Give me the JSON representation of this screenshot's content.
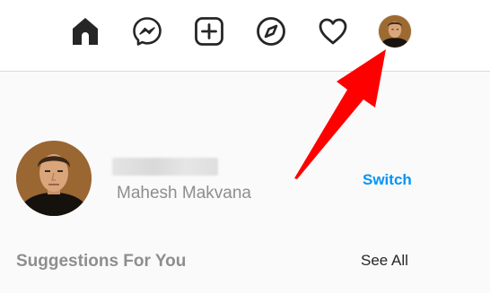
{
  "nav": {
    "icons": [
      "home-icon",
      "messenger-icon",
      "new-post-icon",
      "explore-icon",
      "activity-heart-icon",
      "profile-avatar"
    ]
  },
  "profile": {
    "full_name": "Mahesh Makvana",
    "switch_label": "Switch"
  },
  "suggestions": {
    "title": "Suggestions For You",
    "see_all_label": "See All"
  },
  "colors": {
    "accent": "#0095f6",
    "annotation_arrow": "#ff0000",
    "muted_text": "#8e8e8e",
    "icon": "#262626"
  }
}
